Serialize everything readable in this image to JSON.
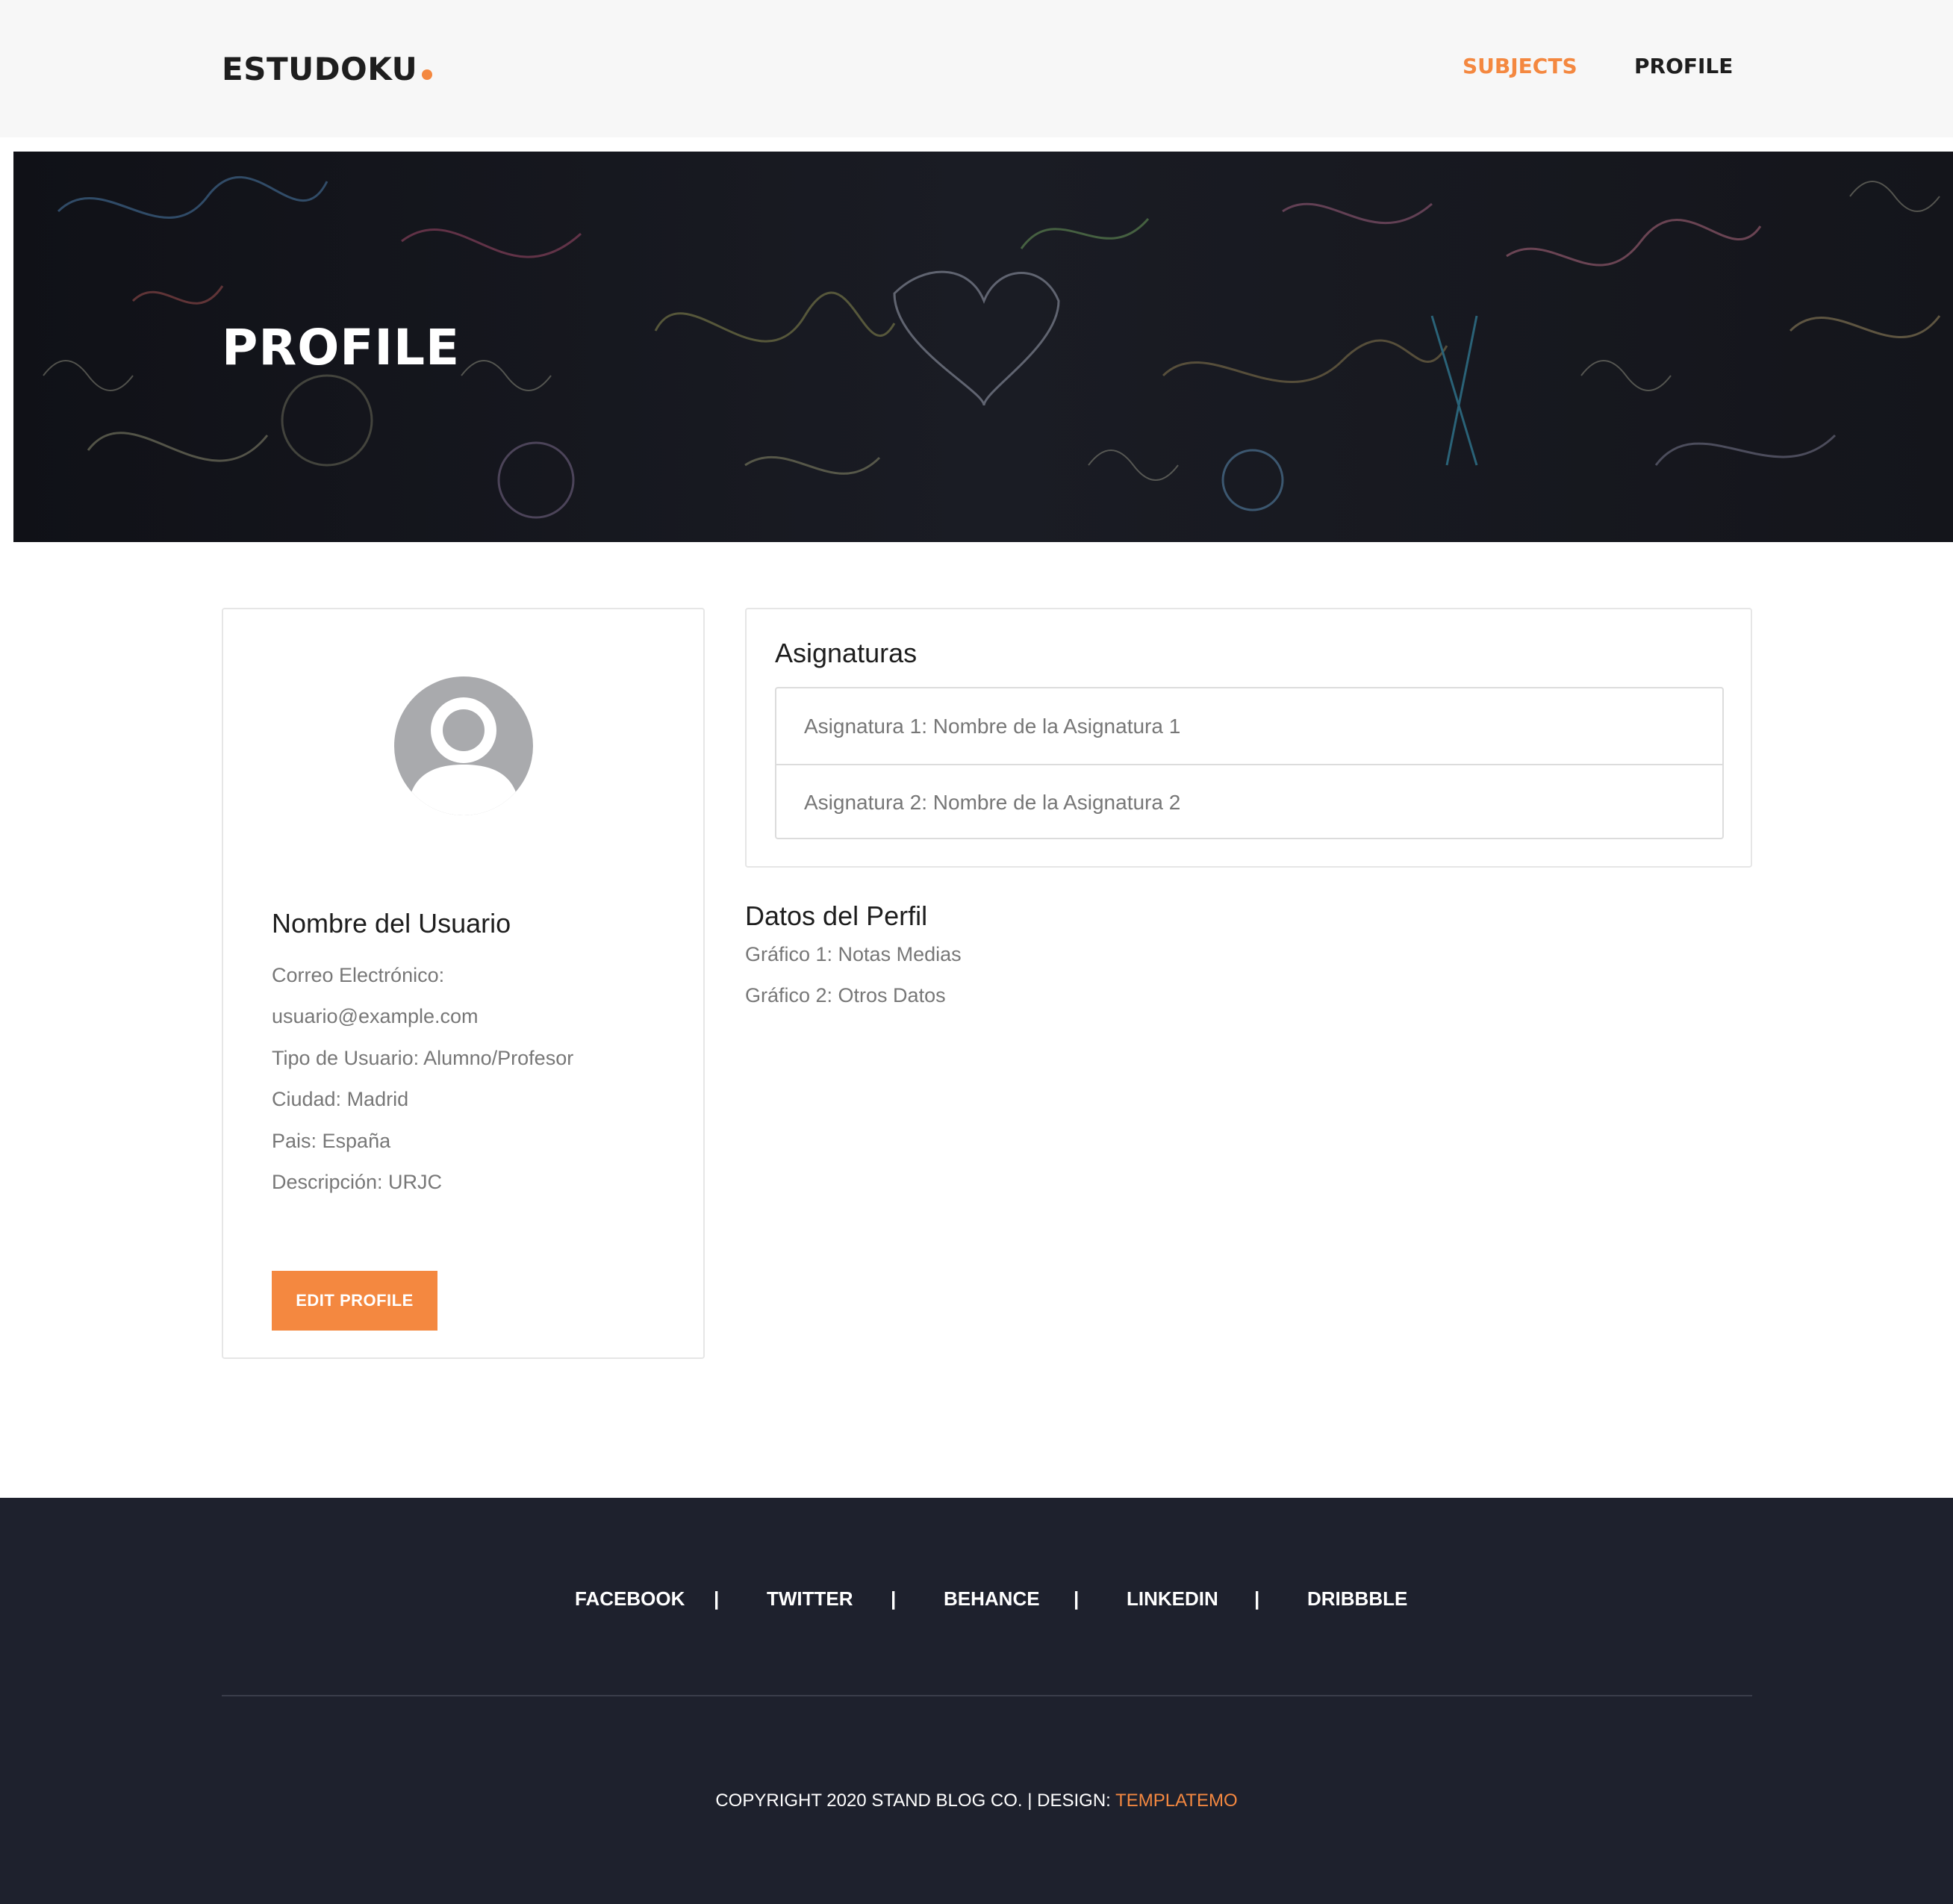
{
  "header": {
    "logo": "ESTUDOKU",
    "nav": [
      {
        "label": "SUBJECTS",
        "active": true
      },
      {
        "label": "PROFILE",
        "active": false
      }
    ]
  },
  "hero": {
    "title": "PROFILE",
    "background": "chalkboard-graffiti-image"
  },
  "profile_card": {
    "avatar": "user-avatar-icon",
    "name": "Nombre del Usuario",
    "email_label": "Correo Electrónico:",
    "email": "usuario@example.com",
    "user_type": "Tipo de Usuario: Alumno/Profesor",
    "city": "Ciudad: Madrid",
    "country": "Pais: España",
    "description": "Descripción: URJC",
    "edit_button": "EDIT PROFILE"
  },
  "subjects": {
    "title": "Asignaturas",
    "items": [
      "Asignatura 1: Nombre de la Asignatura 1",
      "Asignatura 2: Nombre de la Asignatura 2"
    ]
  },
  "profile_data": {
    "title": "Datos del Perfil",
    "charts": [
      "Gráfico 1: Notas Medias",
      "Gráfico 2: Otros Datos"
    ]
  },
  "footer": {
    "social": [
      "FACEBOOK",
      "TWITTER",
      "BEHANCE",
      "LINKEDIN",
      "DRIBBBLE"
    ],
    "separator": "|",
    "copyright_prefix": "COPYRIGHT 2020 STAND BLOG CO. | DESIGN: ",
    "copyright_link": "TEMPLATEMO"
  },
  "colors": {
    "accent": "#f48840",
    "header_bg": "#f7f7f7",
    "footer_bg": "#1e212d",
    "muted_text": "#777777"
  }
}
